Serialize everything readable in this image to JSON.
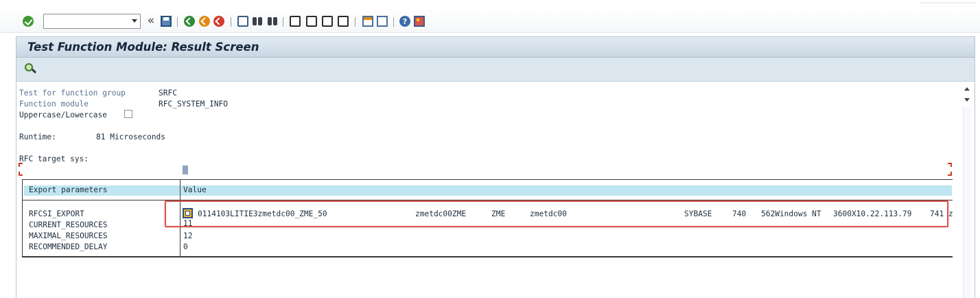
{
  "command_field": {
    "value": ""
  },
  "toolbar_icons": [
    "ok-icon",
    "command-field",
    "history-icon",
    "save-icon",
    "back-icon",
    "exit-icon",
    "cancel-icon",
    "print-icon",
    "find-icon",
    "find-next-icon",
    "first-page-icon",
    "previous-page-icon",
    "next-page-icon",
    "last-page-icon",
    "create-session-icon",
    "shortcut-icon",
    "help-icon",
    "layout-icon"
  ],
  "toolbar": {
    "double_arrow": "«",
    "help_label": "?"
  },
  "title": "Test Function Module: Result Screen",
  "info": {
    "function_group_label": "Test for function group",
    "function_group_value": "SRFC",
    "function_module_label": "Function module",
    "function_module_value": "RFC_SYSTEM_INFO",
    "case_label": "Uppercase/Lowercase",
    "runtime_label": "Runtime:",
    "runtime_value": "81 Microseconds",
    "rfc_target_label": "RFC target sys:"
  },
  "table": {
    "col_params": "Export parameters",
    "col_value": "Value",
    "rows": [
      {
        "name": "RFCSI_EXPORT",
        "value": "0114103LITIE3zmetdc00_ZME_50",
        "extra": [
          "zmetdc00ZME",
          "ZME",
          "zmetdc00",
          "SYBASE",
          "740",
          "562Windows NT",
          "3600X10.22.113.79",
          "741 z"
        ]
      },
      {
        "name": "CURRENT_RESOURCES",
        "value": "11"
      },
      {
        "name": "MAXIMAL_RESOURCES",
        "value": "12"
      },
      {
        "name": "RECOMMENDED_DELAY",
        "value": "0"
      }
    ]
  },
  "colors": {
    "title_bar": "#c9d6e2",
    "header_fill": "#bfe6f1",
    "highlight_box": "#d9534f"
  }
}
